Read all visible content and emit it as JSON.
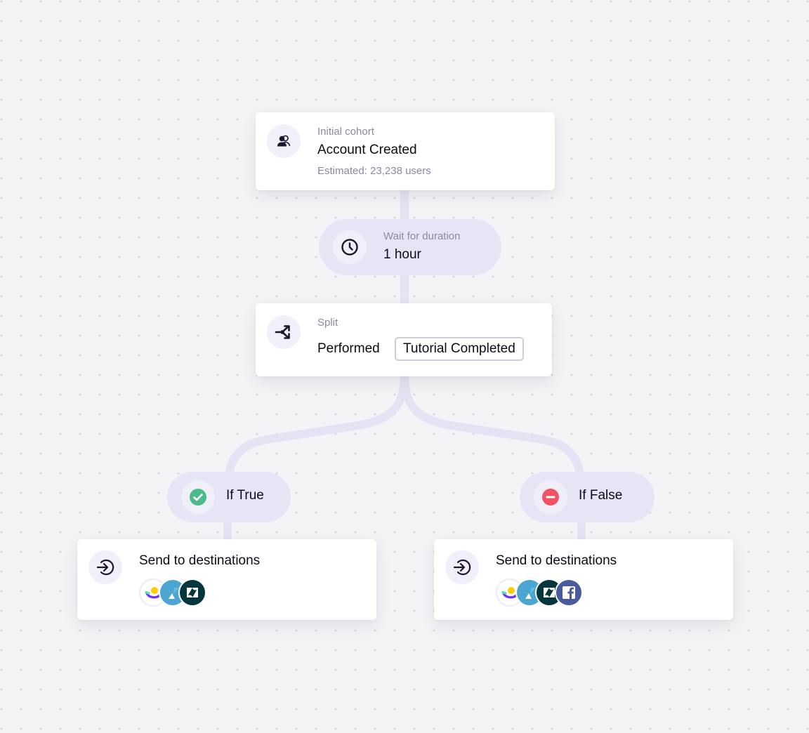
{
  "flow": {
    "cohort": {
      "label": "Initial cohort",
      "title": "Account Created",
      "estimate": "Estimated: 23,238 users",
      "icon": "users-icon"
    },
    "wait": {
      "label": "Wait for duration",
      "value": "1 hour",
      "icon": "clock-icon"
    },
    "split": {
      "label": "Split",
      "condition_prefix": "Performed",
      "condition_event": "Tutorial Completed",
      "icon": "split-icon"
    },
    "branches": [
      {
        "label": "If True",
        "status": "true",
        "status_color": "#4dbb87",
        "icon": "check-circle-icon",
        "action": {
          "title": "Send to destinations",
          "icon": "arrow-into-icon",
          "destinations": [
            "Customer.io",
            "Kustomer",
            "Zendesk"
          ]
        }
      },
      {
        "label": "If False",
        "status": "false",
        "status_color": "#ef5364",
        "icon": "minus-circle-icon",
        "action": {
          "title": "Send to destinations",
          "icon": "arrow-into-icon",
          "destinations": [
            "Customer.io",
            "Kustomer",
            "Zendesk",
            "Facebook"
          ]
        }
      }
    ]
  },
  "colors": {
    "background": "#f4f4f7",
    "connector": "#e4e3f4",
    "pill": "#e6e5f5",
    "text_primary": "#0e0b14",
    "text_secondary": "#8d8aa0",
    "icon_dark": "#1e1530"
  }
}
